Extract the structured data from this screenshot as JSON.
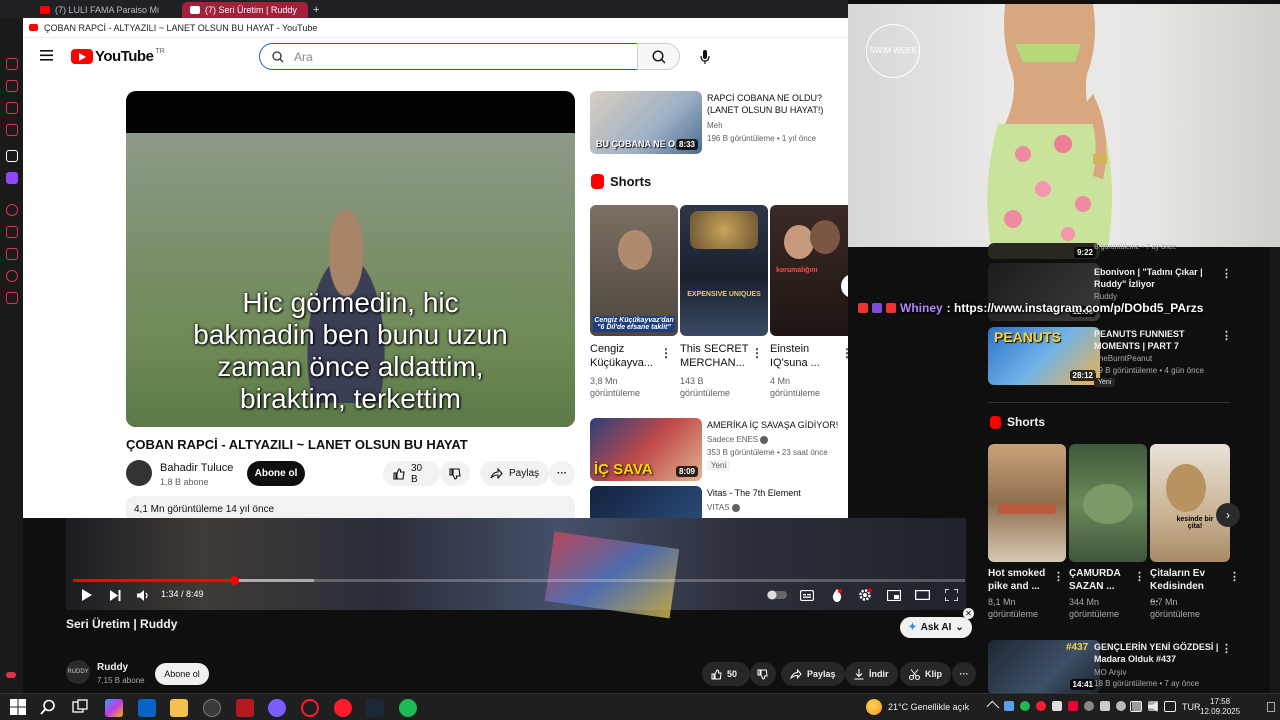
{
  "browser_tabs": [
    {
      "label": "(7) LULI FAMA Paraiso Mi",
      "active": false
    },
    {
      "label": "(7) Seri Üretim | Ruddy",
      "active": true
    }
  ],
  "new_tab_glyph": "+",
  "popup": {
    "window_title": "ÇOBAN RAPCİ - ALTYAZILI ~ LANET OLSUN BU HAYAT - YouTube",
    "logo_text": "YouTube",
    "logo_region": "TR",
    "search": {
      "placeholder": "Ara"
    },
    "video": {
      "subtitle_lines": [
        "Hic görmedin, hic",
        "bakmadin ben bunu uzun",
        "zaman önce aldattim,",
        "biraktim, terkettim"
      ],
      "title": "ÇOBAN RAPCİ - ALTYAZILI ~ LANET OLSUN BU HAYAT",
      "channel": "Bahadir Tuluce",
      "channel_subs": "1,8 B abone",
      "subscribe_label": "Abone ol",
      "likes": "30 B",
      "share_label": "Paylaş",
      "description_meta": "4,1 Mn görüntüleme  14 yıl önce"
    },
    "related_top": {
      "title": "RAPCİ COBANA NE OLDU? (LANET OLSUN BU HAYAT!)",
      "channel": "Meh",
      "meta": "196 B görüntüleme • 1 yıl önce",
      "duration": "8:33",
      "thumb_text": "BU ÇOBANA NE OLDU"
    },
    "shorts_heading": "Shorts",
    "shorts": [
      {
        "title": "Cengiz Küçükayva...",
        "views": "3,8 Mn görüntüleme",
        "thumb_text": "Cengiz Küçükayvaz'dan \"6 Dil'de efsane taklit\""
      },
      {
        "title": "This SECRET MERCHAN...",
        "views": "143 B görüntüleme",
        "thumb_text": "EXPENSIVE UNIQUES"
      },
      {
        "title": "Einstein IQ'suna ...",
        "views": "4 Mn görüntüleme",
        "thumb_text": "korumalığını"
      }
    ],
    "related_list": [
      {
        "title": "AMERİKA İÇ SAVAŞA GİDİYOR!",
        "channel": "Sadece ENES",
        "meta": "353 B görüntüleme • 23 saat önce",
        "duration": "8:09",
        "badge": "Yeni",
        "thumb_text": "İÇ SAVA"
      },
      {
        "title": "Vitas - The 7th Element",
        "channel": "VITAS",
        "meta": "",
        "duration": "",
        "badge": "",
        "thumb_text": ""
      }
    ]
  },
  "runway": {
    "logo_text": "SWIM WEEK"
  },
  "right_column": {
    "top_meta": "B görüntüleme • 7 ay önce",
    "top_duration": "9:22",
    "items": [
      {
        "title": "Ebonivon | \"Tadını Çıkar | Ruddy\" İzliyor",
        "channel": "Ruddy",
        "meta": "",
        "duration": "12:06",
        "badge": ""
      },
      {
        "title": "PEANUTS FUNNIEST MOMENTS | PART 7",
        "channel": "TheBurntPeanut",
        "meta": "99 B görüntüleme • 4 gün önce",
        "duration": "28:12",
        "badge": "Yeni",
        "thumb_text": "PEANUTS"
      }
    ],
    "shorts_heading": "Shorts",
    "shorts": [
      {
        "title": "Hot smoked pike and ...",
        "views": "8,1 Mn görüntüleme"
      },
      {
        "title": "ÇAMURDA SAZAN ...",
        "views": "344 Mn görüntüleme"
      },
      {
        "title": "Çitaların Ev Kedisinden ...",
        "views": "6,7 Mn görüntüleme",
        "thumb_text": "kesinde bir çita!"
      }
    ],
    "bottom_item": {
      "title": "GENÇLERİN YENİ GÖZDESİ | Madara Olduk #437",
      "channel": "MO Arşiv",
      "meta": "18 B görüntüleme • 7 ay önce",
      "duration": "14:41",
      "thumb_text": "#437"
    }
  },
  "instagram_overlay": {
    "name": "Whiney",
    "text": ": https://www.instagram.com/p/DObd5_PArzs"
  },
  "bottom_player": {
    "time": "1:34 / 8:49",
    "progress": 0.18,
    "buffered": 0.27,
    "title": "Seri Üretim | Ruddy",
    "ask_ai_label": "Ask AI",
    "channel": "Ruddy",
    "channel_avatar_text": "RUDDY",
    "channel_subs": "7,15 B abone",
    "subscribe_label": "Abone ol",
    "likes": "50",
    "share_label": "Paylaş",
    "download_label": "İndir",
    "clip_label": "Klip"
  },
  "taskbar": {
    "weather": "21°C  Genellikle açık",
    "language": "TUR",
    "time": "17:58",
    "date": "12.09.2025"
  },
  "colors": {
    "youtube_red": "#ff0000",
    "search_focus": "#1c62b9",
    "tab_active": "#a3203a",
    "dark_bg": "#0f0f0f"
  }
}
